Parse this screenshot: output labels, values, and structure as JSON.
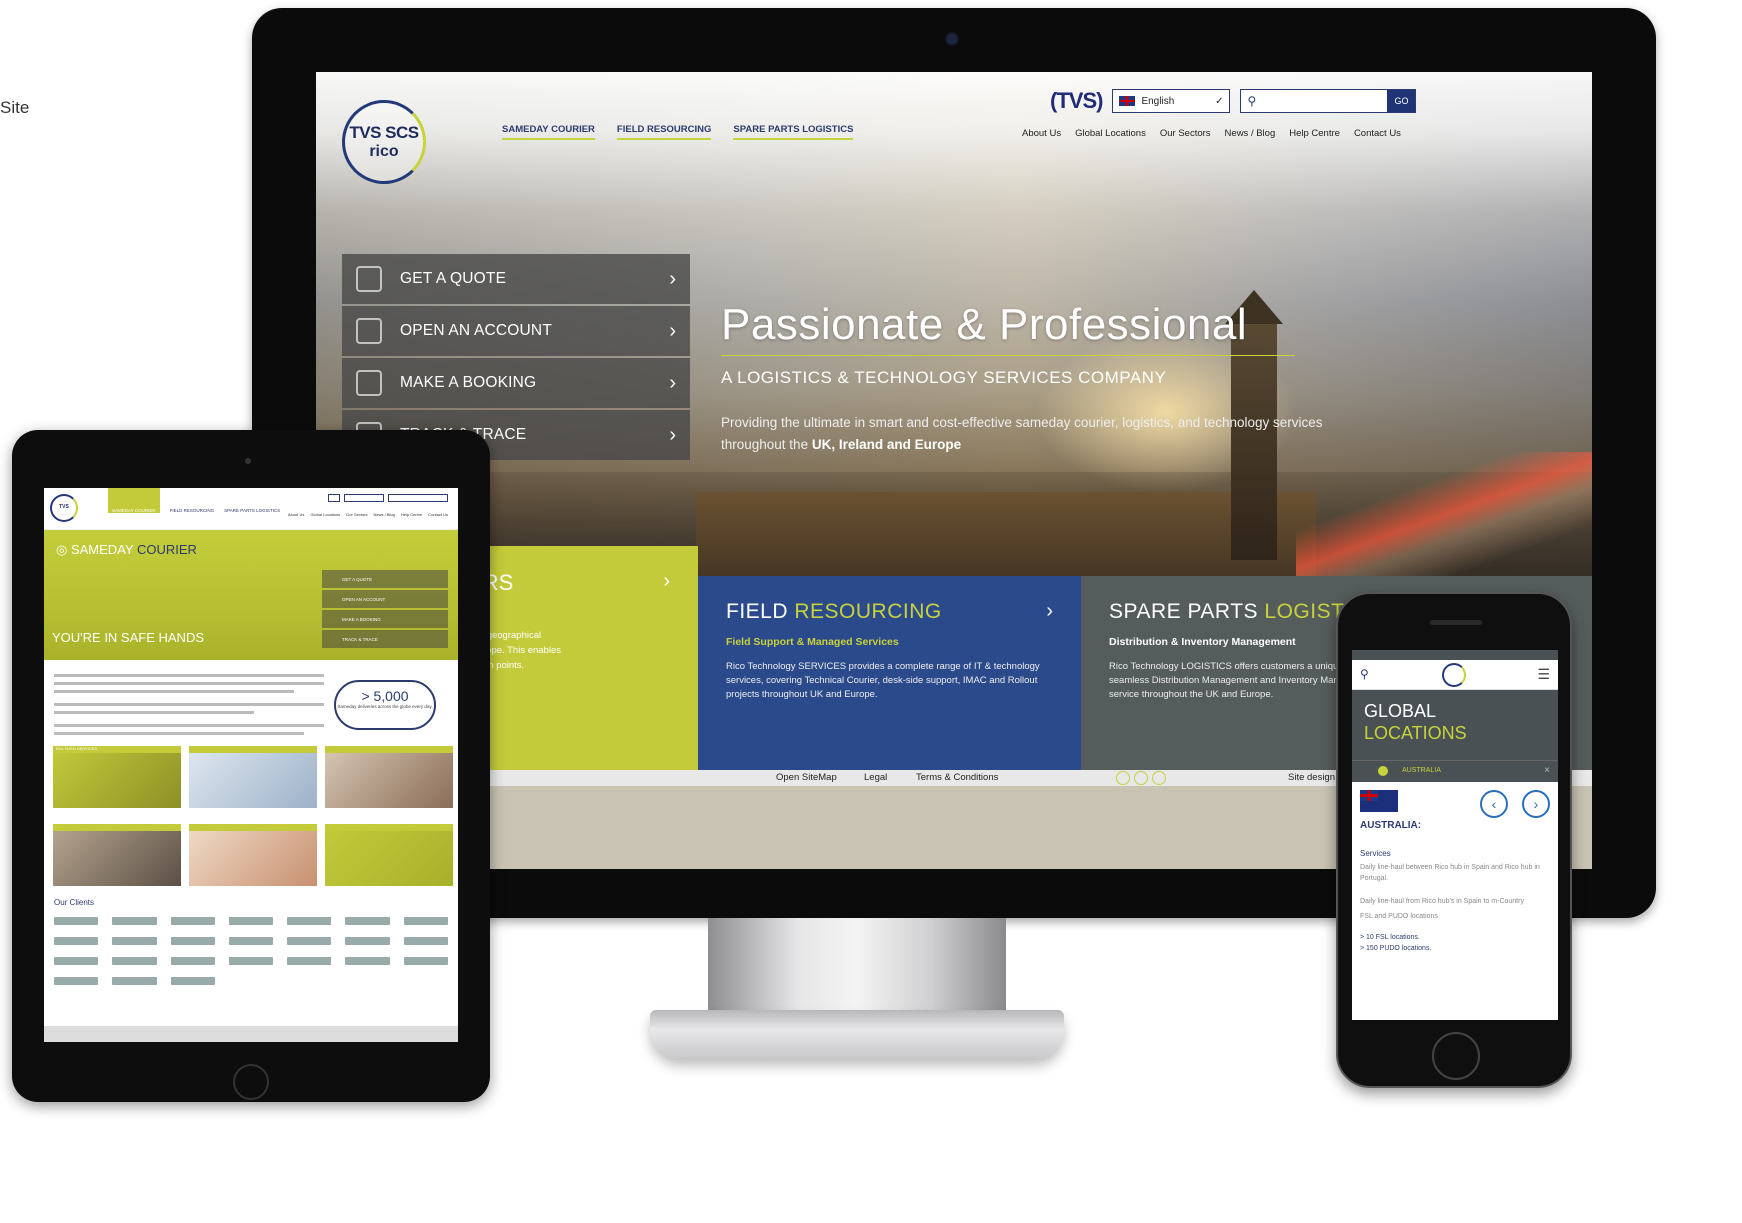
{
  "side_text": "Site",
  "desktop": {
    "logo": {
      "line1": "TVS SCS",
      "line2": "rico"
    },
    "main_nav": [
      "SAMEDAY COURIER",
      "FIELD RESOURCING",
      "SPARE PARTS LOGISTICS"
    ],
    "brand_mark": "(TVS)",
    "language": "English",
    "search": {
      "icon": "search-icon",
      "button": "GO"
    },
    "secondary_nav": [
      "About Us",
      "Global Locations",
      "Our Sectors",
      "News / Blog",
      "Help Centre",
      "Contact Us"
    ],
    "quick_menu": [
      {
        "label": "GET A QUOTE",
        "icon": "quote-calculator-icon"
      },
      {
        "label": "OPEN AN ACCOUNT",
        "icon": "padlock-icon"
      },
      {
        "label": "MAKE A BOOKING",
        "icon": "card-icon"
      },
      {
        "label": "TRACK & TRACE",
        "icon": "box-icon"
      }
    ],
    "hero": {
      "title": "Passionate & Professional",
      "subtitle": "A LOGISTICS & TECHNOLOGY SERVICES COMPANY",
      "desc_prefix": "Providing the ultimate in smart and cost-effective sameday courier, logistics, and technology services throughout the ",
      "desc_bold": "UK, Ireland and Europe"
    },
    "tiles": [
      {
        "title_partial": "IERS",
        "desc_partial": "tegic geographical\ns Europe. This enables\nllection points."
      },
      {
        "title_a": "FIELD ",
        "title_b": "RESOURCING",
        "sub": "Field Support & Managed Services",
        "desc": "Rico Technology SERVICES provides a complete range of IT & technology services, covering Technical Courier, desk-side support, IMAC and Rollout projects throughout UK and Europe."
      },
      {
        "title_a": "SPARE PARTS ",
        "title_b": "LOGISTICS",
        "sub": "Distribution & Inventory Management",
        "desc": "Rico Technology LOGISTICS offers customers a unique an seamless Distribution Management and Inventory Manage service throughout the UK and Europe."
      }
    ],
    "footer": {
      "open": "Open SiteMap",
      "legal": "Legal",
      "terms": "Terms & Conditions",
      "design": "Site design by: D"
    }
  },
  "tablet": {
    "nav": [
      "SAMEDAY COURIER",
      "FIELD RESOURCING",
      "SPARE PARTS LOGISTICS"
    ],
    "links": [
      "About Us",
      "Global Locations",
      "Our Sectors",
      "News / Blog",
      "Help Centre",
      "Contact Us"
    ],
    "hero_title_a": "SAMEDAY ",
    "hero_title_b": "COURIER",
    "safe": "YOU'RE IN SAFE HANDS",
    "quick": [
      "GET A QUOTE",
      "OPEN AN ACCOUNT",
      "MAKE A BOOKING",
      "TRACK & TRACE"
    ],
    "badge_big": "> 5,000",
    "badge_small": "Sameday deliveries across the globe every day.",
    "grid_labels": [
      "ECL FLEXI SERVICES",
      "",
      "",
      "",
      "",
      ""
    ],
    "clients_title": "Our Clients"
  },
  "phone": {
    "title_a": "GLOBAL",
    "title_b": "LOCATIONS",
    "loc": "AUSTRALIA",
    "country": "AUSTRALIA:",
    "services": "Services",
    "text1": "Daily line-haul between Rico hub in Spain and Rico hub in Portugal.",
    "text2": "Daily line-haul from Rico hub's in Spain to m-Country",
    "text3": "FSL and PUDO locations",
    "bullet1": "> 10 FSL locations.",
    "bullet2": "> 150 PUDO locations."
  }
}
